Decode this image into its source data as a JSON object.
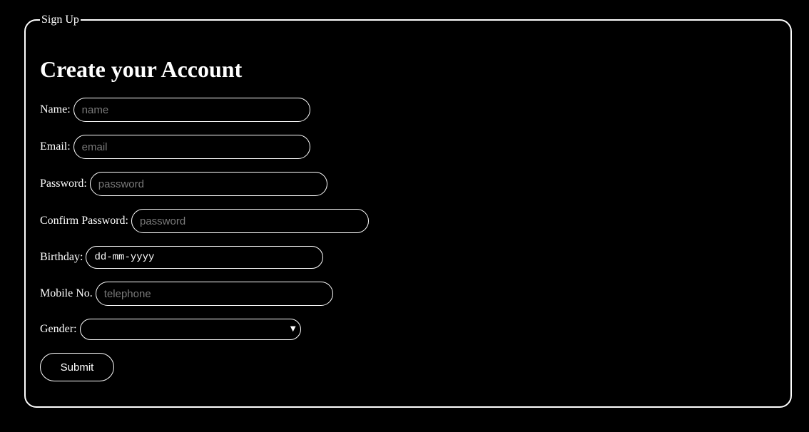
{
  "legend": "Sign Up",
  "title": "Create your Account",
  "fields": [
    {
      "label": "Name:",
      "placeholder": "name"
    },
    {
      "label": "Email:",
      "placeholder": "email"
    },
    {
      "label": "Password:",
      "placeholder": "password"
    },
    {
      "label": "Confirm Password:",
      "placeholder": "password"
    },
    {
      "label": "Birthday:",
      "value": "dd-mm-yyyy"
    },
    {
      "label": "Mobile No.",
      "placeholder": "telephone"
    }
  ],
  "gender": {
    "label": "Gender:",
    "selected": "",
    "caret_icon": "triangle-down-icon"
  },
  "submit_label": "Submit",
  "colors": {
    "background": "#000000",
    "foreground": "#ffffff",
    "placeholder": "#7a7a7a"
  }
}
